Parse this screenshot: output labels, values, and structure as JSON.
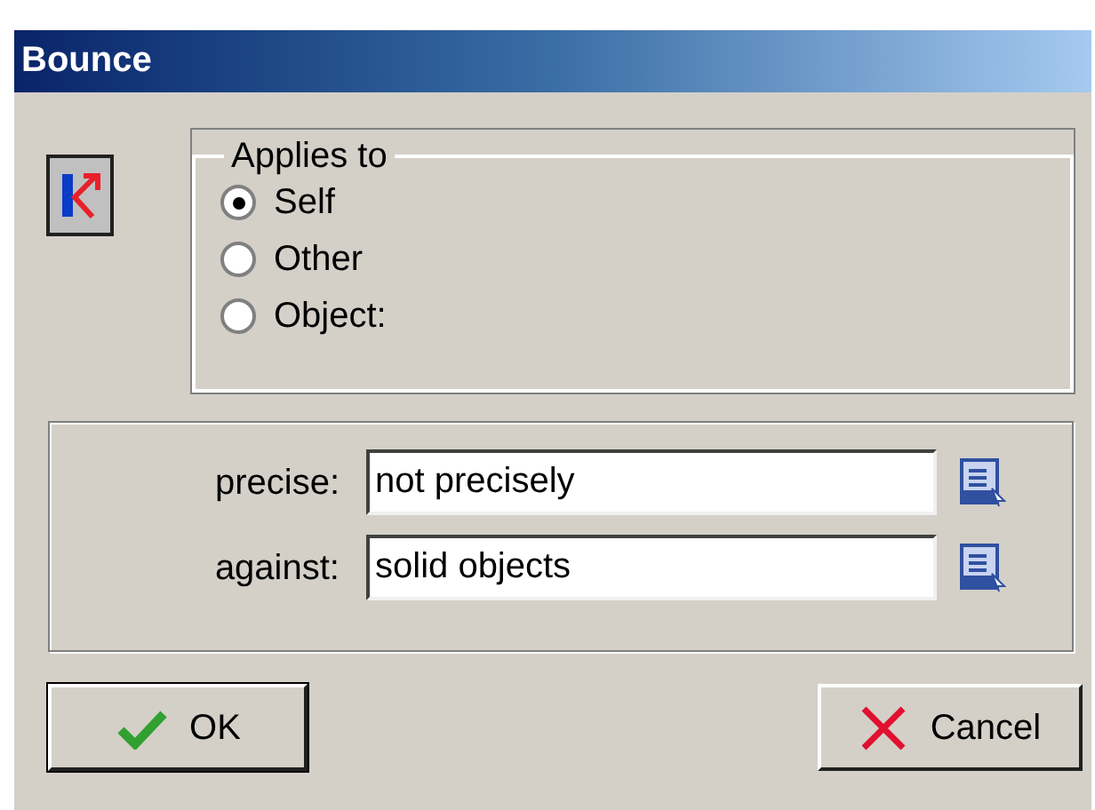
{
  "window": {
    "title": "Bounce"
  },
  "applies_to": {
    "label": "Applies to",
    "options": [
      {
        "label": "Self",
        "selected": true
      },
      {
        "label": "Other",
        "selected": false
      },
      {
        "label": "Object:",
        "selected": false
      }
    ]
  },
  "fields": [
    {
      "label": "precise:",
      "value": "not precisely"
    },
    {
      "label": "against:",
      "value": "solid objects"
    }
  ],
  "buttons": [
    {
      "label": "OK",
      "kind": "ok"
    },
    {
      "label": "Cancel",
      "kind": "cancel"
    }
  ]
}
